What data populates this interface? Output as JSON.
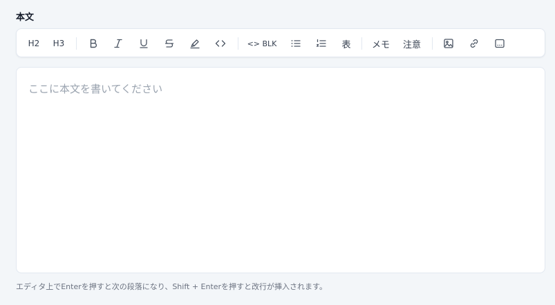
{
  "field": {
    "label": "本文"
  },
  "toolbar": {
    "h2": "H2",
    "h3": "H3",
    "code_block": "<> BLK",
    "table": "表",
    "memo": "メモ",
    "caution": "注意",
    "icons": [
      "bold-icon",
      "italic-icon",
      "underline-icon",
      "strikethrough-icon",
      "highlight-icon",
      "code-icon",
      "bullet-list-icon",
      "ordered-list-icon",
      "image-icon",
      "link-icon",
      "embed-icon"
    ]
  },
  "editor": {
    "placeholder": "ここに本文を書いてください"
  },
  "hint": "エディタ上でEnterを押すと次の段落になり、Shift + Enterを押すと改行が挿入されます。",
  "colors": {
    "background": "#f3f6f9",
    "icon": "#4b5563",
    "placeholder": "#9aa3af"
  }
}
